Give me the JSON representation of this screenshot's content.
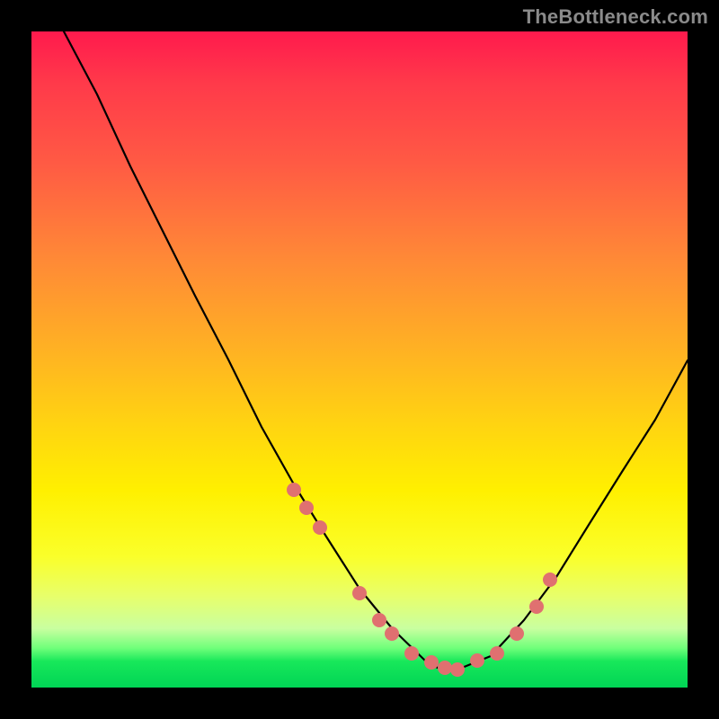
{
  "watermark": "TheBottleneck.com",
  "chart_data": {
    "type": "line",
    "title": "",
    "xlabel": "",
    "ylabel": "",
    "xlim": [
      0,
      100
    ],
    "ylim": [
      0,
      100
    ],
    "grid": false,
    "legend": false,
    "series": [
      {
        "name": "bottleneck-curve",
        "x": [
          5,
          10,
          15,
          20,
          25,
          30,
          35,
          40,
          45,
          50,
          55,
          60,
          62,
          65,
          70,
          75,
          80,
          85,
          90,
          95,
          100
        ],
        "y": [
          100,
          90,
          80,
          70,
          60,
          50,
          40,
          31,
          23,
          15,
          9,
          4,
          3,
          3,
          5,
          10,
          17,
          25,
          33,
          41,
          50
        ]
      }
    ],
    "markers": {
      "name": "highlight-points",
      "color": "#e86a6a",
      "x": [
        40,
        42,
        44,
        50,
        53,
        55,
        58,
        61,
        63,
        65,
        68,
        71,
        74,
        77,
        79
      ],
      "y": [
        30,
        27,
        24,
        14,
        10,
        8,
        5,
        4,
        3,
        3,
        4,
        5,
        8,
        12,
        17
      ]
    },
    "background_gradient": {
      "top": "#ff1a4d",
      "bottom": "#00d455"
    }
  }
}
